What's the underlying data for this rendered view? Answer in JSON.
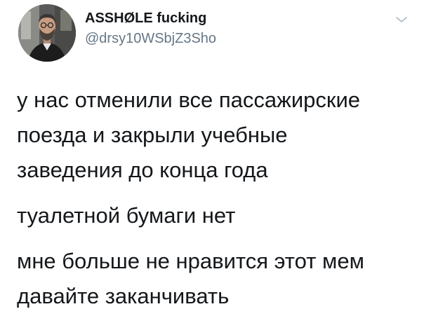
{
  "author": {
    "display_name": "ASSHØLE fucking",
    "handle": "@drsy10WSbjZ3Sho"
  },
  "tweet": {
    "paragraphs": [
      {
        "lines": [
          "у нас отменили все пассажирские",
          "поезда и закрыли учебные",
          "заведения до конца года"
        ]
      },
      {
        "lines": [
          "туалетной бумаги нет"
        ]
      },
      {
        "lines": [
          "мне больше не нравится этот мем",
          "давайте заканчивать"
        ]
      }
    ]
  },
  "icons": {
    "menu": "chevron-down-icon",
    "avatar": "avatar"
  },
  "colors": {
    "text": "#14171a",
    "secondary": "#657786",
    "background": "#ffffff"
  }
}
